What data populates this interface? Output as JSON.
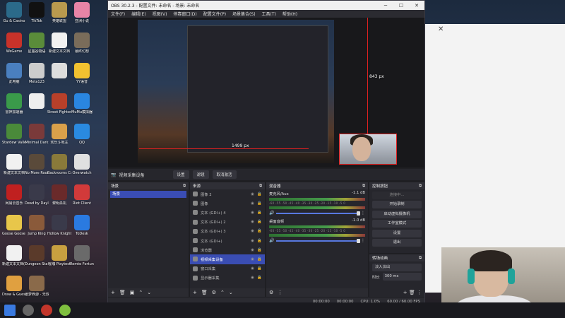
{
  "desktop_icons": [
    {
      "label": "Gu & Casino",
      "color": "#2b6a8a"
    },
    {
      "label": "TikTok",
      "color": "#111"
    },
    {
      "label": "英雄联盟",
      "color": "#b99a4e"
    },
    {
      "label": "亚洲小说",
      "color": "#e884a7"
    },
    {
      "label": "WeGame",
      "color": "#c8322a"
    },
    {
      "label": "星露谷物语",
      "color": "#5a8c3a"
    },
    {
      "label": "新建文本文档",
      "color": "#f1f1f1"
    },
    {
      "label": "最终幻想",
      "color": "#7a6c5a"
    },
    {
      "label": "此电脑",
      "color": "#4a7fbf"
    },
    {
      "label": "Meta123",
      "color": "#ccc"
    },
    {
      "label": "",
      "color": "#ddd"
    },
    {
      "label": "YY语音",
      "color": "#f2c230"
    },
    {
      "label": "雷神加速器",
      "color": "#3a9a4a"
    },
    {
      "label": "",
      "color": "#eee"
    },
    {
      "label": "Street Fighter 6",
      "color": "#b8402a"
    },
    {
      "label": "MuMu模拟器",
      "color": "#2a86e0"
    },
    {
      "label": "Stardew Valley",
      "color": "#4a8a3a"
    },
    {
      "label": "Minimal Dark",
      "color": "#7a3a3a"
    },
    {
      "label": "欢乐斗地主",
      "color": "#d9a04a"
    },
    {
      "label": "QQ",
      "color": "#2a8ae0"
    },
    {
      "label": "新建文本文档",
      "color": "#f1f1f1"
    },
    {
      "label": "No More Room in Hell",
      "color": "#5a4a3a"
    },
    {
      "label": "Backrooms Company",
      "color": "#8a7a3a"
    },
    {
      "label": "Overwatch",
      "color": "#e0e0e0"
    },
    {
      "label": "网易云音乐",
      "color": "#c02020"
    },
    {
      "label": "Dead by Daylight",
      "color": "#3a3a4a"
    },
    {
      "label": "黎明杀机",
      "color": "#6a2a2a"
    },
    {
      "label": "Riot Client",
      "color": "#d23a3a"
    },
    {
      "label": "Goose Goose Duck",
      "color": "#e8c64a"
    },
    {
      "label": "Jump King",
      "color": "#8a5a3a"
    },
    {
      "label": "Hollow Knight",
      "color": "#3a3a4a"
    },
    {
      "label": "ToDesk",
      "color": "#2a7ae0"
    },
    {
      "label": "新建文本文档(5)",
      "color": "#f1f1f1"
    },
    {
      "label": "Dungeon Stalkers",
      "color": "#5a3a2a"
    },
    {
      "label": "雀魂 Playtest",
      "color": "#c8a040"
    },
    {
      "label": "Remto Fortune",
      "color": "#6a6a6a"
    },
    {
      "label": "Draw & Guess",
      "color": "#e0a040"
    },
    {
      "label": "道梦西游 · 无双",
      "color": "#8a6a4a"
    }
  ],
  "obs": {
    "title": "OBS 30.2.3 - 配置文件: 未命名 - 场景: 未命名",
    "menu": [
      "文件(F)",
      "编辑(E)",
      "视图(V)",
      "停靠窗口(D)",
      "配置文件(P)",
      "场景集合(S)",
      "工具(T)",
      "帮助(H)"
    ],
    "measure_vertical": "843 px",
    "measure_horizontal": "1499 px",
    "source_toolbar": {
      "selected_source": "视频采集设备",
      "buttons": [
        "设置",
        "滤镜",
        "取消激活"
      ]
    },
    "scenes": {
      "title": "场景",
      "items": [
        "场景"
      ]
    },
    "sources": {
      "title": "来源",
      "items": [
        "图像 2",
        "图像",
        "文本 (GDI+) 4",
        "文本 (GDI+) 2",
        "文本 (GDI+) 3",
        "文本 (GDI+)",
        "浏览器",
        "视频采集设备",
        "窗口采集",
        "显示器采集"
      ],
      "selected_index": 7
    },
    "mixer": {
      "title": "混音器",
      "channels": [
        {
          "name": "麦克风/Aux",
          "db": "-1.1 dB"
        },
        {
          "name": "桌面音频",
          "db": "-1.0 dB"
        }
      ],
      "scale": "-60 -55 -50 -45 -40 -35 -30 -25 -20 -15 -10 -5 0"
    },
    "controls": {
      "title": "控制按钮",
      "buttons": [
        "连接中...",
        "开始录制",
        "启动虚拟摄像机",
        "工作室模式",
        "设置",
        "退出"
      ]
    },
    "transitions": {
      "title": "转场动画",
      "type": "淡入淡出",
      "duration_label": "时长",
      "duration_value": "300 ms"
    },
    "status": {
      "time1": "00:00:00",
      "time2": "00:00:00",
      "cpu": "CPU: 1.0%",
      "fps": "60.00 / 60.00 FPS"
    }
  }
}
